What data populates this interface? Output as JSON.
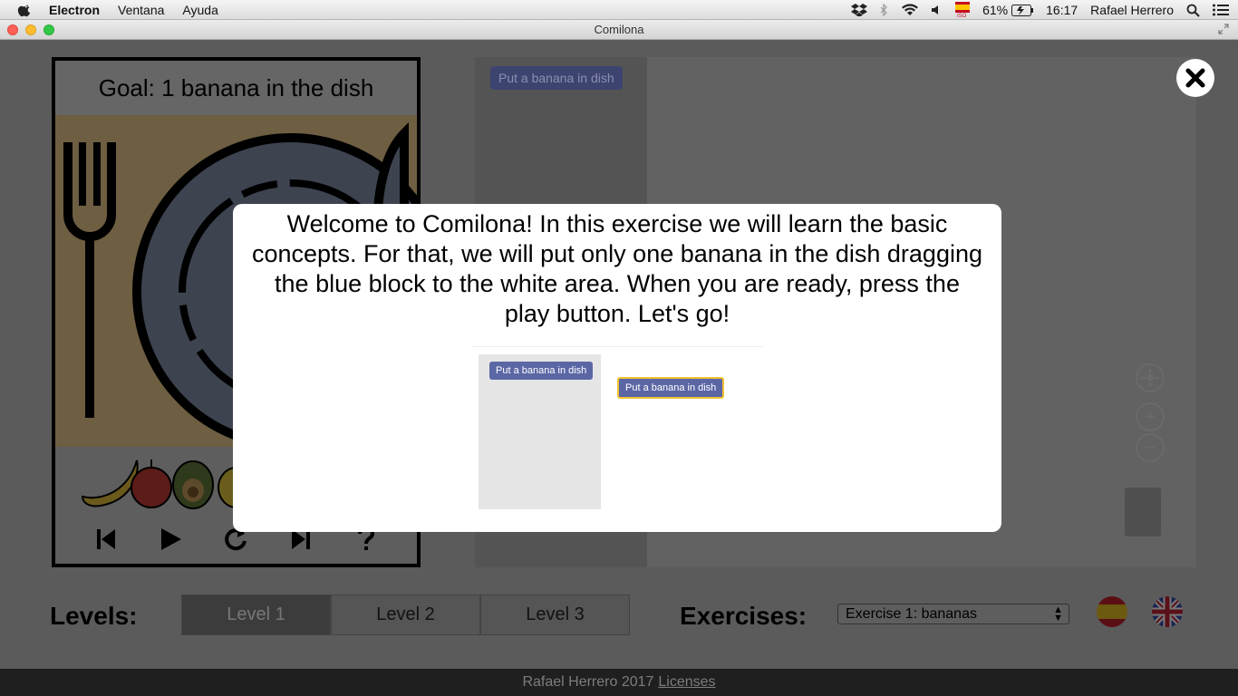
{
  "menubar": {
    "app_name": "Electron",
    "items": [
      "Ventana",
      "Ayuda"
    ],
    "battery": "61%",
    "time": "16:17",
    "user": "Rafael Herrero"
  },
  "window": {
    "title": "Comilona"
  },
  "stage": {
    "goal": "Goal: 1 banana in the dish"
  },
  "workspace": {
    "toolbox_block": "Put a banana in dish"
  },
  "levels": {
    "label": "Levels:",
    "items": [
      "Level 1",
      "Level 2",
      "Level 3"
    ],
    "active": "Level 1"
  },
  "exercises": {
    "label": "Exercises:",
    "selected": "Exercise 1: bananas"
  },
  "footer": {
    "text": "Rafael Herrero 2017",
    "link": "Licenses"
  },
  "modal": {
    "message": "Welcome to Comilona! In this exercise we will learn the basic concepts. For that, we will put only one banana in the dish dragging the blue block to the white area. When you are ready, press the play button. Let's go!",
    "demo_toolbox_block": "Put a banana in dish",
    "demo_dragged_block": "Put a banana in dish"
  },
  "colors": {
    "block": "#5b67a5",
    "selected_outline": "#f1c232",
    "overlay": "#5b5b5b"
  }
}
